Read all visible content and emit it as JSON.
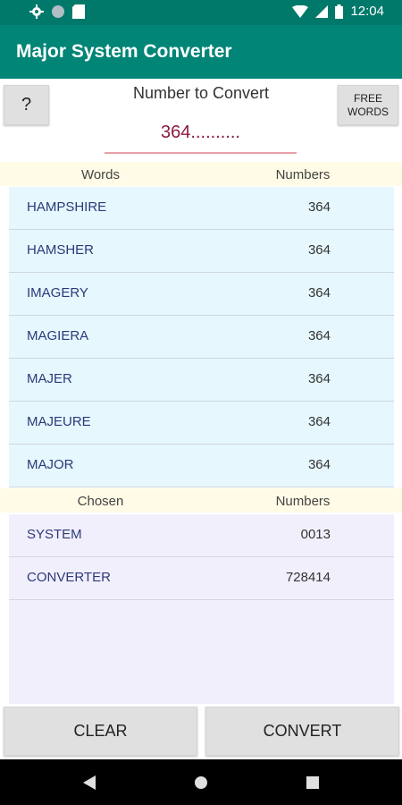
{
  "status": {
    "time": "12:04"
  },
  "app": {
    "title": "Major System Converter"
  },
  "controls": {
    "help_label": "?",
    "free_words_label": "FREE\nWORDS",
    "input_label": "Number to Convert",
    "input_value": "364.........."
  },
  "words_header": {
    "col1": "Words",
    "col2": "Numbers"
  },
  "words": [
    {
      "word": "HAMPSHIRE",
      "number": "364"
    },
    {
      "word": "HAMSHER",
      "number": "364"
    },
    {
      "word": "IMAGERY",
      "number": "364"
    },
    {
      "word": "MAGIERA",
      "number": "364"
    },
    {
      "word": "MAJER",
      "number": "364"
    },
    {
      "word": "MAJEURE",
      "number": "364"
    },
    {
      "word": "MAJOR",
      "number": "364"
    }
  ],
  "chosen_header": {
    "col1": "Chosen",
    "col2": "Numbers"
  },
  "chosen": [
    {
      "word": "SYSTEM",
      "number": "0013"
    },
    {
      "word": "CONVERTER",
      "number": "728414"
    }
  ],
  "buttons": {
    "clear": "CLEAR",
    "convert": "CONVERT"
  },
  "colors": {
    "status_bar": "#00796b",
    "app_bar": "#008577",
    "input_text": "#8b1a3f",
    "word_text": "#2a3a7a"
  }
}
